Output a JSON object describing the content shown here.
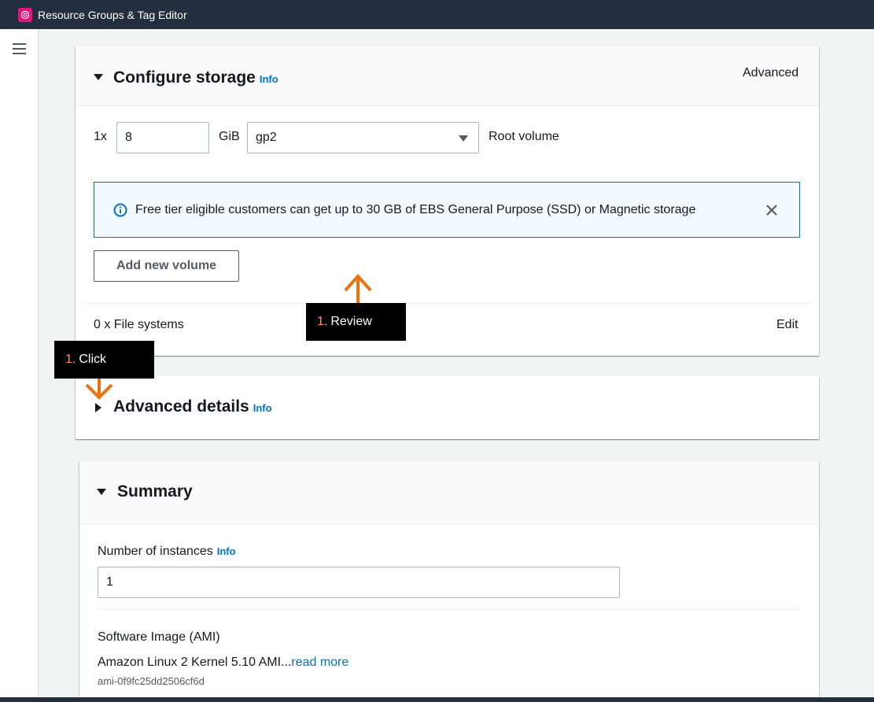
{
  "topbar": {
    "app_title": "Resource Groups & Tag Editor",
    "app_icon": "resource-groups-icon",
    "app_icon_color": "#e7157b"
  },
  "sidebar": {
    "menu_icon": "hamburger-menu-icon"
  },
  "configure_storage": {
    "title": "Configure storage",
    "info": "Info",
    "advanced_link": "Advanced",
    "volume": {
      "count_label": "1x",
      "size_value": "8",
      "unit_label": "GiB",
      "type_value": "gp2",
      "role_label": "Root volume"
    },
    "alert": {
      "text": "Free tier eligible customers can get up to 30 GB of EBS General Purpose (SSD) or Magnetic storage"
    },
    "add_volume_button": "Add new volume",
    "file_systems_label": "0 x File systems",
    "edit_link": "Edit"
  },
  "advanced_details": {
    "title": "Advanced details",
    "info": "Info"
  },
  "summary": {
    "title": "Summary",
    "instances_label": "Number of instances",
    "instances_info": "Info",
    "instances_value": "1",
    "ami_link": "Software Image (AMI)",
    "ami_name": "Amazon Linux 2 Kernel 5.10 AMI...",
    "ami_read_more": "read more",
    "ami_id": "ami-0f9fc25dd2506cf6d"
  },
  "callouts": [
    {
      "number": "1.",
      "text": "Review"
    },
    {
      "number": "1.",
      "text": "Click"
    }
  ],
  "colors": {
    "accent_link": "#0073bb",
    "callout_arrow": "#ec7211",
    "topbar_bg": "#232f3e"
  }
}
